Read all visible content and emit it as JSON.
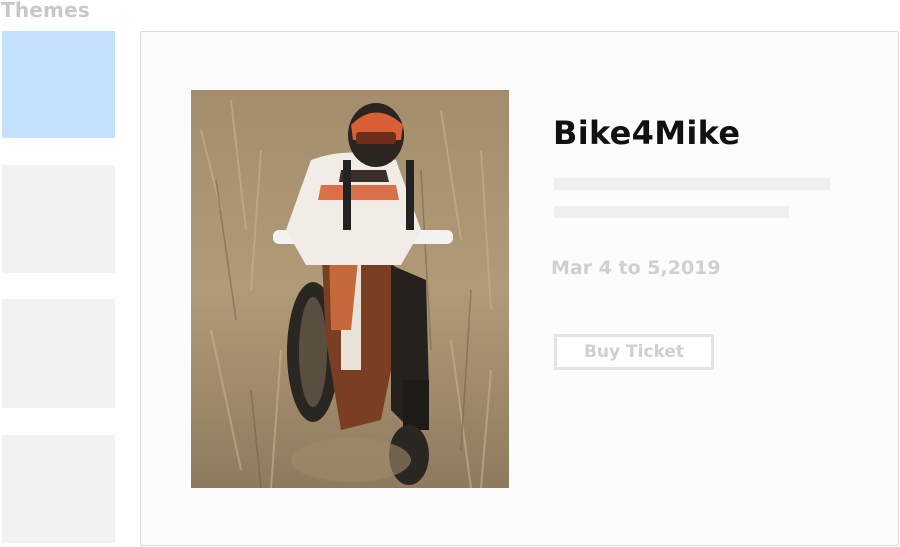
{
  "sidebar": {
    "heading": "Themes",
    "themes": [
      {
        "selected": true,
        "color": "#c4e2ff"
      },
      {
        "selected": false,
        "color": "#f2f2f2"
      },
      {
        "selected": false,
        "color": "#f2f2f2"
      },
      {
        "selected": false,
        "color": "#f2f2f2"
      }
    ]
  },
  "event": {
    "title": "Bike4Mike",
    "date": "Mar 4 to 5,2019",
    "buy_label": "Buy Ticket"
  },
  "colors": {
    "accent_selected": "#c4e2ff",
    "title": "#111111",
    "muted": "#d0d0d0"
  }
}
